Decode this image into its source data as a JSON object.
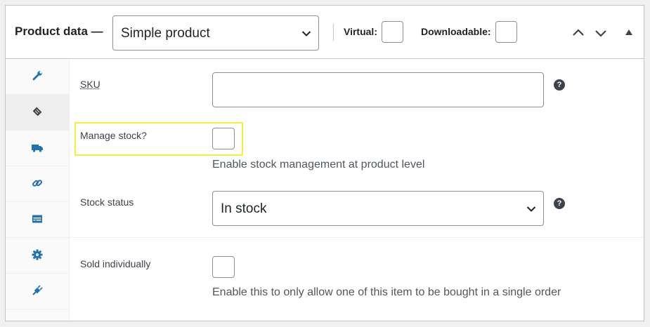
{
  "header": {
    "title": "Product data —",
    "product_type": "Simple product",
    "virtual_label": "Virtual:",
    "downloadable_label": "Downloadable:"
  },
  "tabs": [
    {
      "icon": "wrench-icon",
      "active": false
    },
    {
      "icon": "tag-icon",
      "active": true
    },
    {
      "icon": "truck-icon",
      "active": false
    },
    {
      "icon": "link-icon",
      "active": false
    },
    {
      "icon": "card-icon",
      "active": false
    },
    {
      "icon": "gear-icon",
      "active": false
    },
    {
      "icon": "plug-icon",
      "active": false
    }
  ],
  "inventory": {
    "sku_label": "SKU",
    "sku_value": "",
    "manage_stock_label": "Manage stock?",
    "manage_stock_desc": "Enable stock management at product level",
    "stock_status_label": "Stock status",
    "stock_status_value": "In stock",
    "sold_individually_label": "Sold individually",
    "sold_individually_desc": "Enable this to only allow one of this item to be bought in a single order",
    "help_glyph": "?"
  },
  "colors": {
    "accent": "#2271b1",
    "highlight": "#f3ef3a",
    "border": "#c3c4c7"
  }
}
